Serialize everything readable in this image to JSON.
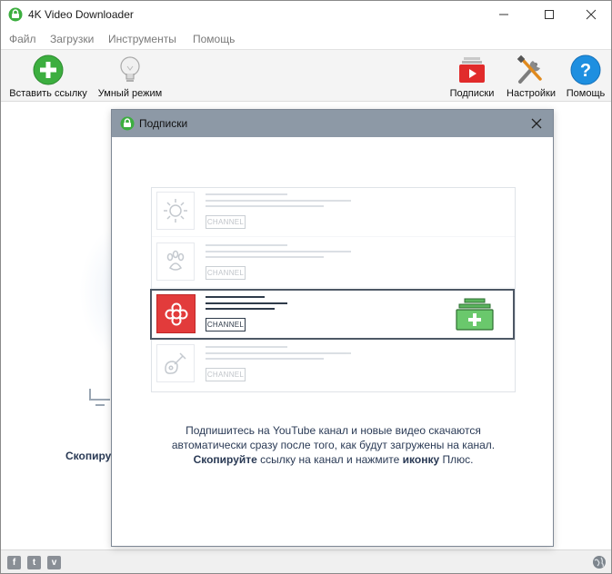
{
  "window": {
    "title": "4K Video Downloader"
  },
  "menu": {
    "items": [
      "Файл",
      "Загрузки",
      "Инструменты",
      "Помощь"
    ]
  },
  "toolbar": {
    "paste_label": "Вставить ссылку",
    "smart_label": "Умный режим",
    "subscriptions_label": "Подписки",
    "settings_label": "Настройки",
    "help_label": "Помощь"
  },
  "main": {
    "hint_partial": "Скопиру"
  },
  "dialog": {
    "title": "Подписки",
    "illustration": {
      "channel_tag": "CHANNEL"
    },
    "description": {
      "line1": "Подпишитесь на YouTube канал и новые видео скачаются",
      "line2": "автоматически сразу после того, как будут загружены на канал.",
      "line3_bold1": "Скопируйте",
      "line3_text1": " ссылку на канал и нажмите ",
      "line3_bold2": "иконку",
      "line3_text2": " Плюс."
    }
  },
  "statusbar": {
    "social": [
      "f",
      "t",
      "v"
    ]
  },
  "colors": {
    "accent_green": "#3cae3f",
    "dialog_title_bg": "#8d99a6",
    "channel_red": "#e23b3b",
    "help_blue": "#1e8fe0"
  },
  "icons": {
    "app": "4k-logo-icon",
    "paste": "green-plus-circle-icon",
    "smart": "lightbulb-icon",
    "subscriptions": "youtube-play-icon",
    "settings": "wrench-screwdriver-icon",
    "help": "question-circle-icon"
  }
}
